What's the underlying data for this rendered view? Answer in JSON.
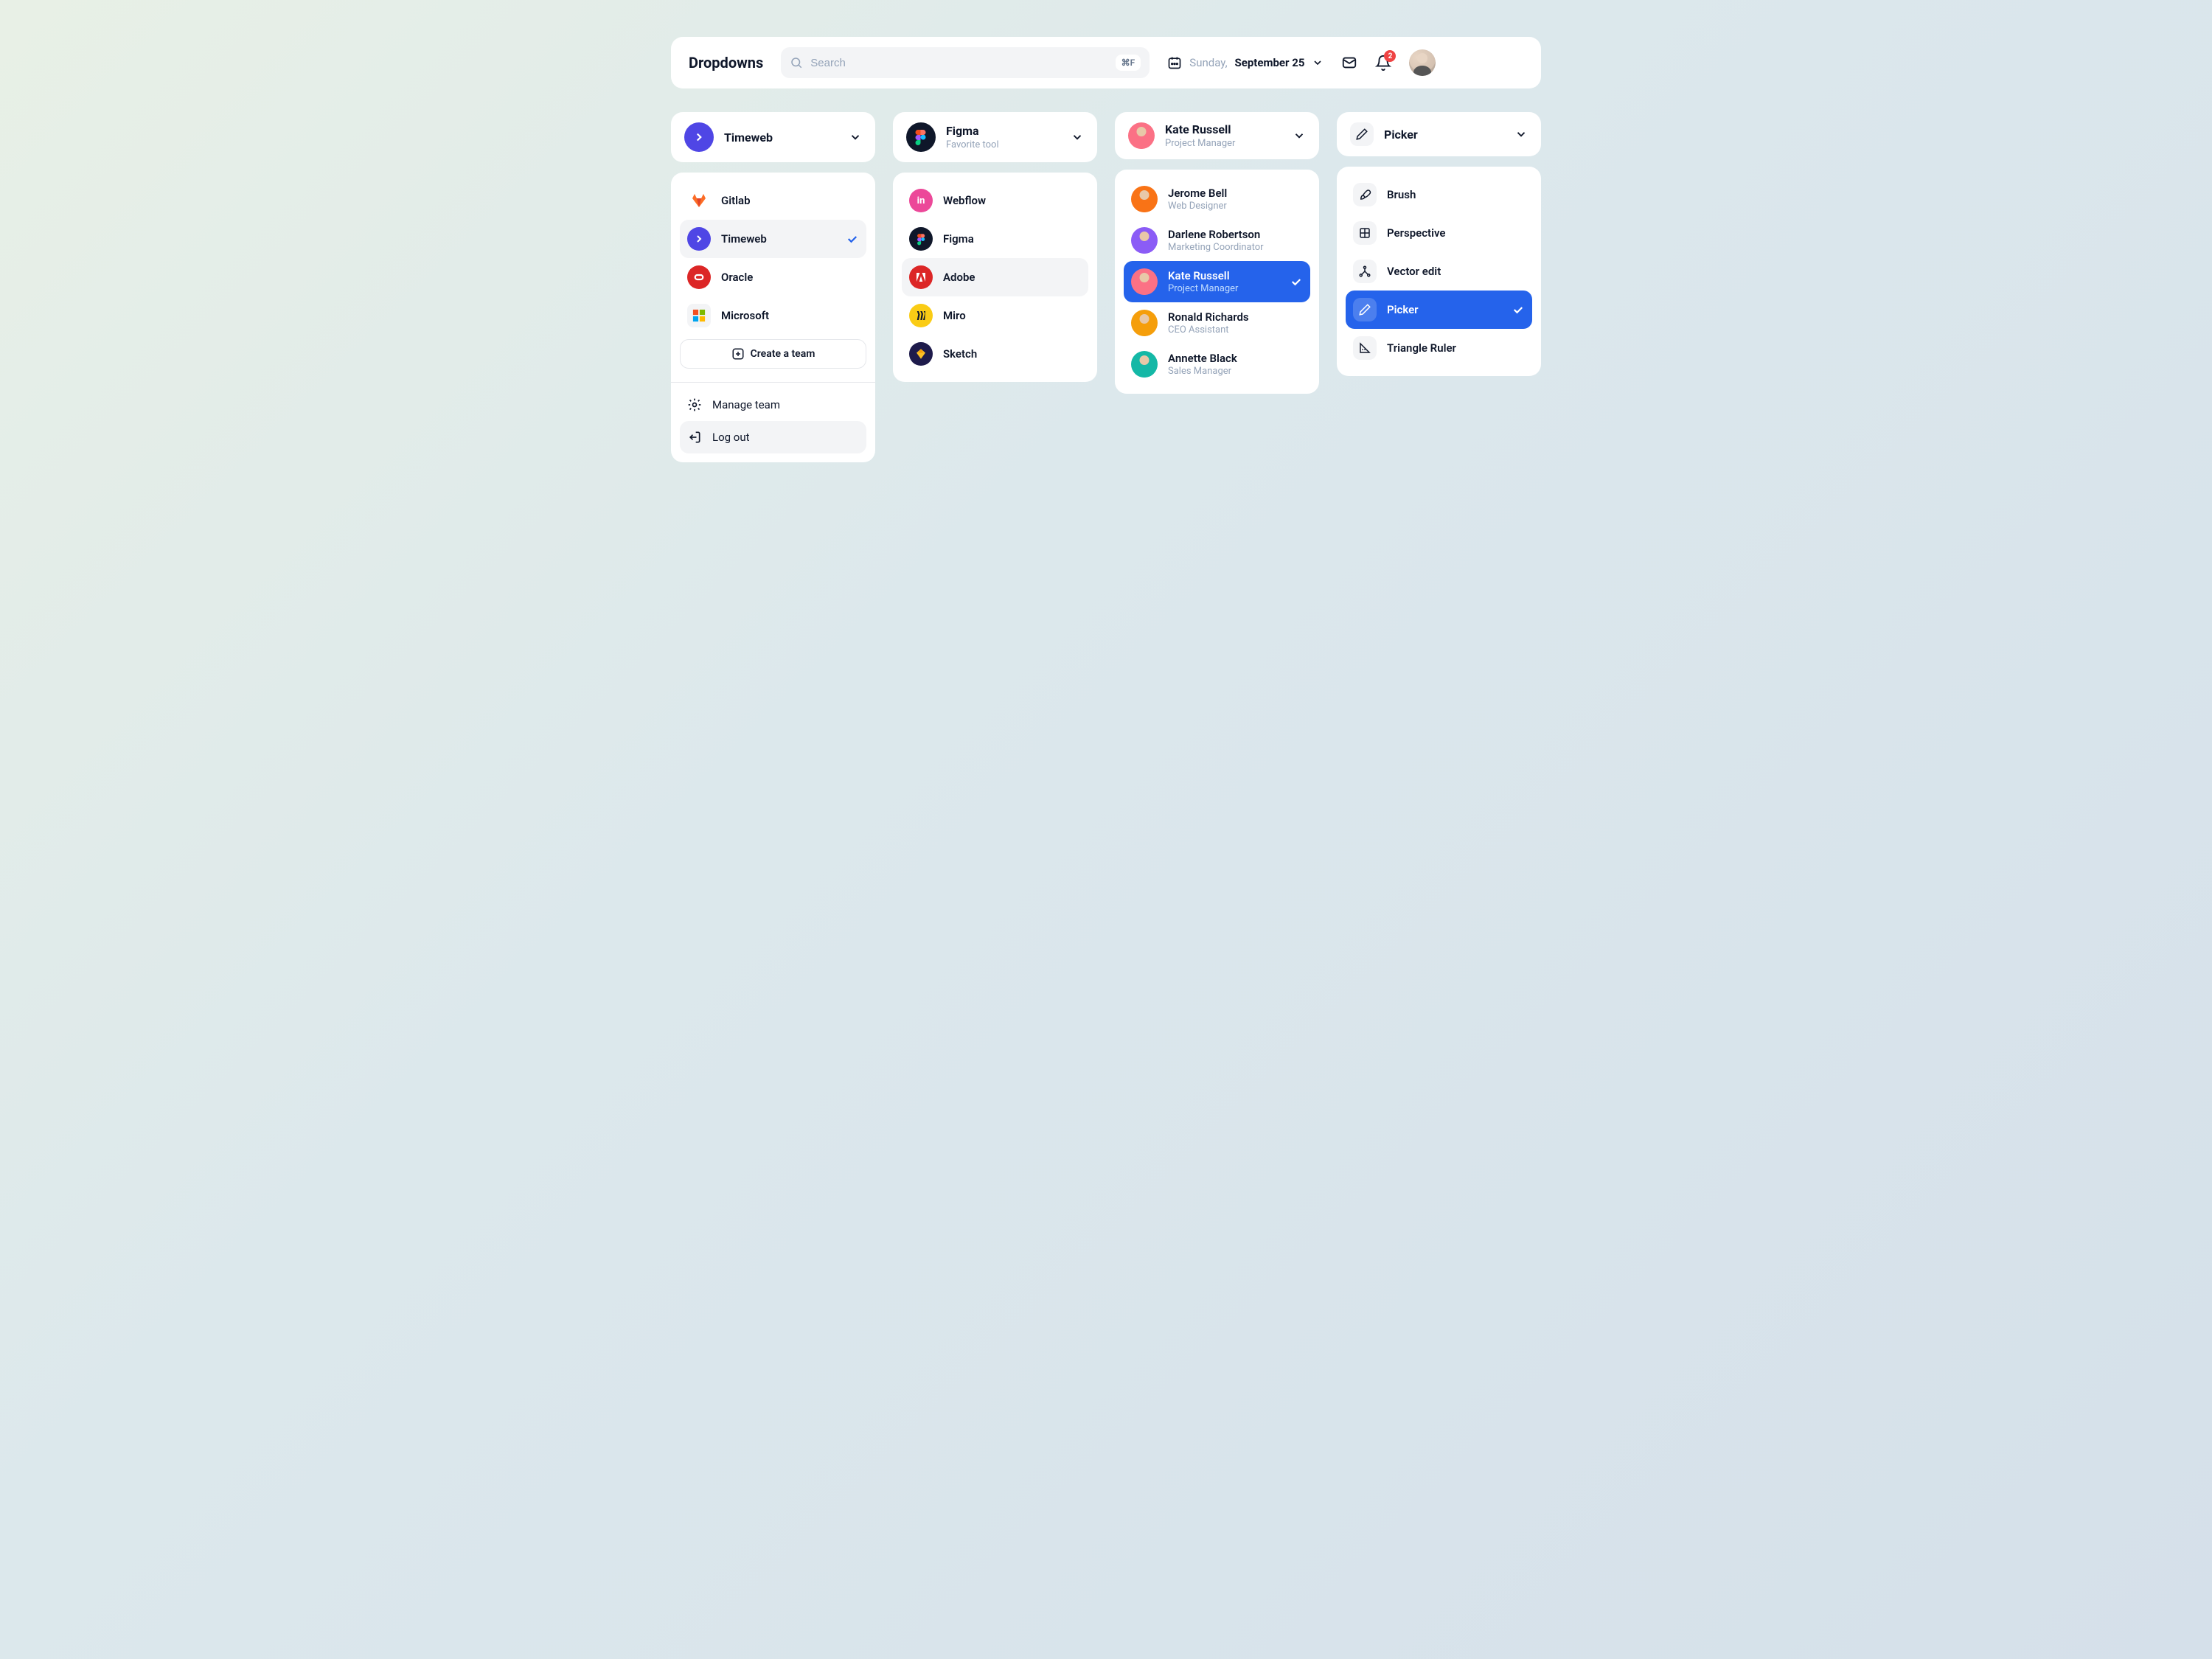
{
  "header": {
    "title": "Dropdowns",
    "search_placeholder": "Search",
    "search_shortcut": "⌘F",
    "date_day": "Sunday,",
    "date_value": "September 25",
    "notification_count": "2"
  },
  "col1": {
    "trigger": {
      "title": "Timeweb"
    },
    "items": [
      {
        "label": "Gitlab"
      },
      {
        "label": "Timeweb"
      },
      {
        "label": "Oracle"
      },
      {
        "label": "Microsoft"
      }
    ],
    "create_label": "Create a team",
    "manage_label": "Manage team",
    "logout_label": "Log out"
  },
  "col2": {
    "trigger": {
      "title": "Figma",
      "sub": "Favorite tool"
    },
    "items": [
      {
        "label": "Webflow"
      },
      {
        "label": "Figma"
      },
      {
        "label": "Adobe"
      },
      {
        "label": "Miro"
      },
      {
        "label": "Sketch"
      }
    ]
  },
  "col3": {
    "trigger": {
      "title": "Kate Russell",
      "sub": "Project Manager"
    },
    "items": [
      {
        "name": "Jerome Bell",
        "role": "Web Designer"
      },
      {
        "name": "Darlene Robertson",
        "role": "Marketing Coordinator"
      },
      {
        "name": "Kate Russell",
        "role": "Project Manager"
      },
      {
        "name": "Ronald Richards",
        "role": "CEO Assistant"
      },
      {
        "name": "Annette Black",
        "role": "Sales Manager"
      }
    ]
  },
  "col4": {
    "trigger": {
      "title": "Picker"
    },
    "items": [
      {
        "label": "Brush"
      },
      {
        "label": "Perspective"
      },
      {
        "label": "Vector edit"
      },
      {
        "label": "Picker"
      },
      {
        "label": "Triangle Ruler"
      }
    ]
  }
}
